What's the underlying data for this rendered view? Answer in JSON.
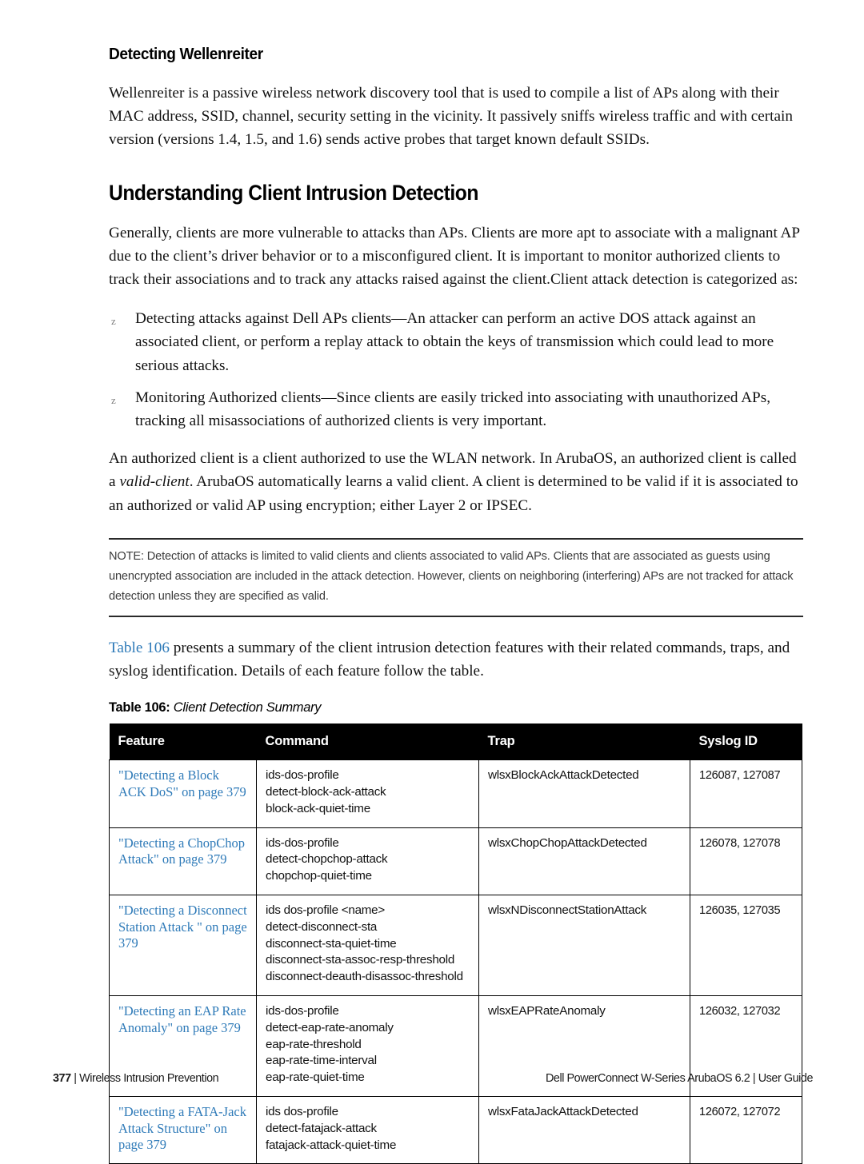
{
  "document": {
    "section_heading": "Detecting Wellenreiter",
    "wellenreiter_paragraph": "Wellenreiter is a passive wireless network discovery tool that is used to compile a list of APs along with their MAC address, SSID, channel, security setting in the vicinity. It passively sniffs wireless traffic and with certain version (versions 1.4, 1.5, and 1.6) sends active probes that target known default SSIDs.",
    "main_heading": "Understanding Client Intrusion Detection",
    "intro_paragraph": "Generally, clients are more vulnerable to attacks than APs. Clients are more apt to associate with a malignant AP due to the client’s driver behavior or to a misconfigured client. It is important to monitor authorized clients to track their associations and to track any attacks raised against the client.Client attack detection is categorized as:",
    "bullets": [
      {
        "bullet_glyph": "z",
        "text": "Detecting attacks against Dell APs clients—An attacker can perform an active DOS attack against an associated client, or perform a replay attack to obtain the keys of transmission which could lead to more serious attacks."
      },
      {
        "bullet_glyph": "z",
        "text": "Monitoring Authorized clients—Since clients are easily tricked into associating with unauthorized APs, tracking all misassociations of authorized clients is very important."
      }
    ],
    "valid_client_paragraph": {
      "part1": "An authorized client is a client authorized to use the WLAN network. In ArubaOS, an authorized client is called a ",
      "italic_term": "valid-client",
      "part2": ". ArubaOS automatically learns a valid client. A client is determined to be valid if it is associated to an authorized or valid AP using encryption; either Layer 2 or IPSEC."
    },
    "note": {
      "text": "NOTE: Detection of attacks is limited to valid clients and clients associated to valid APs. Clients that are associated as guests using unencrypted association are included in the attack detection. However, clients on neighboring (interfering) APs are not tracked for attack detection unless they are specified as valid."
    },
    "table_intro": {
      "link_text": "Table 106",
      "rest": " presents a summary of the client intrusion detection features with their related commands, traps, and syslog identification. Details of each feature follow the table."
    }
  },
  "table": {
    "caption_label": "Table 106:",
    "caption_title": "Client Detection Summary",
    "link_color": "#2E7AB8",
    "header_background": "#000000",
    "columns": [
      "Feature",
      "Command",
      "Trap",
      "Syslog ID"
    ],
    "rows": [
      {
        "feature": "\"Detecting a Block ACK DoS\" on page 379",
        "commands": [
          "ids-dos-profile",
          "detect-block-ack-attack",
          "block-ack-quiet-time"
        ],
        "trap": "wlsxBlockAckAttackDetected",
        "syslog": "126087, 127087"
      },
      {
        "feature": "\"Detecting a ChopChop Attack\" on page 379",
        "commands": [
          "ids-dos-profile",
          "detect-chopchop-attack",
          "chopchop-quiet-time"
        ],
        "trap": "wlsxChopChopAttackDetected",
        "syslog": "126078, 127078"
      },
      {
        "feature": "\"Detecting a Disconnect Station Attack \" on page 379",
        "commands": [
          "ids dos-profile <name>",
          "detect-disconnect-sta",
          "disconnect-sta-quiet-time",
          "disconnect-sta-assoc-resp-threshold",
          "disconnect-deauth-disassoc-threshold"
        ],
        "trap": "wlsxNDisconnectStationAttack",
        "syslog": "126035, 127035"
      },
      {
        "feature": "\"Detecting an EAP Rate Anomaly\" on page 379",
        "commands": [
          "ids-dos-profile",
          "detect-eap-rate-anomaly",
          "eap-rate-threshold",
          "eap-rate-time-interval",
          "eap-rate-quiet-time"
        ],
        "trap": "wlsxEAPRateAnomaly",
        "syslog": "126032, 127032"
      },
      {
        "feature": "\"Detecting a FATA-Jack Attack Structure\" on page 379",
        "commands": [
          "ids dos-profile",
          "detect-fatajack-attack",
          "fatajack-attack-quiet-time"
        ],
        "trap": "wlsxFataJackAttackDetected",
        "syslog": "126072, 127072"
      }
    ]
  },
  "footer": {
    "page_number": "377",
    "separator": "|",
    "left_title": "Wireless Intrusion Prevention",
    "right_text": "Dell PowerConnect W-Series ArubaOS 6.2  |  User Guide"
  }
}
